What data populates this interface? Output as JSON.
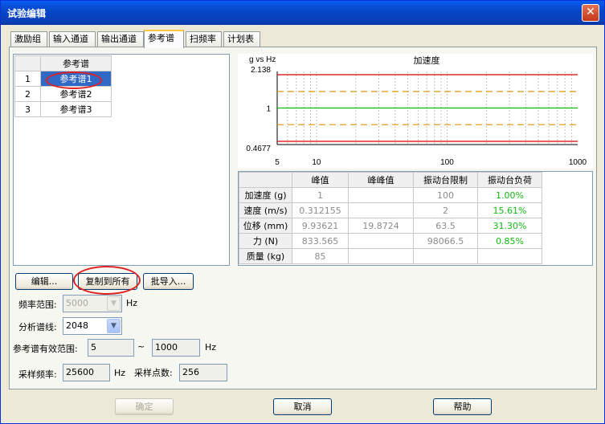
{
  "window": {
    "title": "试验编辑",
    "close_glyph": "✕"
  },
  "tabs": [
    {
      "label": "激励组"
    },
    {
      "label": "输入通道"
    },
    {
      "label": "输出通道"
    },
    {
      "label": "参考谱",
      "active": true
    },
    {
      "label": "扫频率"
    },
    {
      "label": "计划表"
    }
  ],
  "ref_list": {
    "header": "参考谱",
    "rows": [
      {
        "index": "1",
        "name": "参考谱1",
        "selected": true
      },
      {
        "index": "2",
        "name": "参考谱2"
      },
      {
        "index": "3",
        "name": "参考谱3"
      }
    ]
  },
  "chart_data": {
    "type": "line",
    "title": "加速度",
    "ylabel": "g vs Hz",
    "xscale": "log",
    "yscale": "log",
    "xlim": [
      5,
      1000
    ],
    "ylim": [
      0.4677,
      2.138
    ],
    "y_ticks": [
      "2.138",
      "1",
      "0.4677"
    ],
    "x_ticks": [
      "5",
      "10",
      "100",
      "1000"
    ],
    "grid": true,
    "series": [
      {
        "style": "solid",
        "color": "#dd0000",
        "x": [
          5,
          1000
        ],
        "y": [
          2.0,
          2.0
        ]
      },
      {
        "style": "dashed",
        "color": "#e0a020",
        "x": [
          5,
          1000
        ],
        "y": [
          1.41,
          1.41
        ]
      },
      {
        "style": "solid",
        "color": "#00c000",
        "x": [
          5,
          1000
        ],
        "y": [
          1.0,
          1.0
        ]
      },
      {
        "style": "dashed",
        "color": "#e0a020",
        "x": [
          5,
          1000
        ],
        "y": [
          0.707,
          0.707
        ]
      },
      {
        "style": "solid",
        "color": "#dd0000",
        "x": [
          5,
          1000
        ],
        "y": [
          0.5,
          0.5
        ]
      }
    ]
  },
  "metrics": {
    "headers": [
      "",
      "峰值",
      "峰峰值",
      "振动台限制",
      "振动台负荷"
    ],
    "rows": [
      {
        "label": "加速度 (g)",
        "peak": "1",
        "p2p": "",
        "limit": "100",
        "load": "1.00%"
      },
      {
        "label": "速度 (m/s)",
        "peak": "0.312155",
        "p2p": "",
        "limit": "2",
        "load": "15.61%"
      },
      {
        "label": "位移 (mm)",
        "peak": "9.93621",
        "p2p": "19.8724",
        "limit": "63.5",
        "load": "31.30%"
      },
      {
        "label": "力 (N)",
        "peak": "833.565",
        "p2p": "",
        "limit": "98066.5",
        "load": "0.85%"
      },
      {
        "label": "质量 (kg)",
        "peak": "85",
        "p2p": "",
        "limit": "",
        "load": ""
      }
    ]
  },
  "buttons": {
    "edit": "编辑...",
    "copy_all": "复制到所有",
    "batch_import": "批导入..."
  },
  "form": {
    "freq_range_label": "频率范围:",
    "freq_range_value": "5000",
    "freq_range_unit": "Hz",
    "lines_label": "分析谱线:",
    "lines_value": "2048",
    "valid_range_label": "参考谱有效范围:",
    "valid_from": "5",
    "tilde": "~",
    "valid_to": "1000",
    "valid_unit": "Hz",
    "sample_rate_label": "采样频率:",
    "sample_rate_value": "25600",
    "sample_rate_unit": "Hz",
    "sample_points_label": "采样点数:",
    "sample_points_value": "256"
  },
  "footer": {
    "ok": "确定",
    "cancel": "取消",
    "help": "帮助"
  },
  "icons": {
    "dropdown": "▼"
  }
}
